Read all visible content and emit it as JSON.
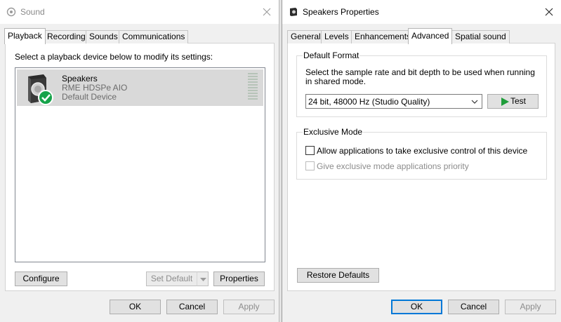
{
  "sound": {
    "title": "Sound",
    "tabs": [
      {
        "label": "Playback"
      },
      {
        "label": "Recording"
      },
      {
        "label": "Sounds"
      },
      {
        "label": "Communications"
      }
    ],
    "instruction": "Select a playback device below to modify its settings:",
    "device": {
      "name": "Speakers",
      "driver": "RME HDSPe AIO",
      "status": "Default Device",
      "icon": "speaker-icon"
    },
    "buttons": {
      "configure": "Configure",
      "set_default": "Set Default",
      "properties": "Properties",
      "ok": "OK",
      "cancel": "Cancel",
      "apply": "Apply"
    }
  },
  "props": {
    "title": "Speakers Properties",
    "tabs": [
      {
        "label": "General"
      },
      {
        "label": "Levels"
      },
      {
        "label": "Enhancements"
      },
      {
        "label": "Advanced"
      },
      {
        "label": "Spatial sound"
      }
    ],
    "default_format": {
      "label": "Default Format",
      "description_line1": "Select the sample rate and bit depth to be used when running",
      "description_line2": "in shared mode.",
      "selected": "24 bit, 48000 Hz (Studio Quality)",
      "test_label": "Test"
    },
    "exclusive_mode": {
      "label": "Exclusive Mode",
      "allow_label": "Allow applications to take exclusive control of this device",
      "priority_label": "Give exclusive mode applications priority"
    },
    "buttons": {
      "restore": "Restore Defaults",
      "ok": "OK",
      "cancel": "Cancel",
      "apply": "Apply"
    }
  },
  "colors": {
    "accent": "#0078d7",
    "checkmark": "#16a34a"
  }
}
